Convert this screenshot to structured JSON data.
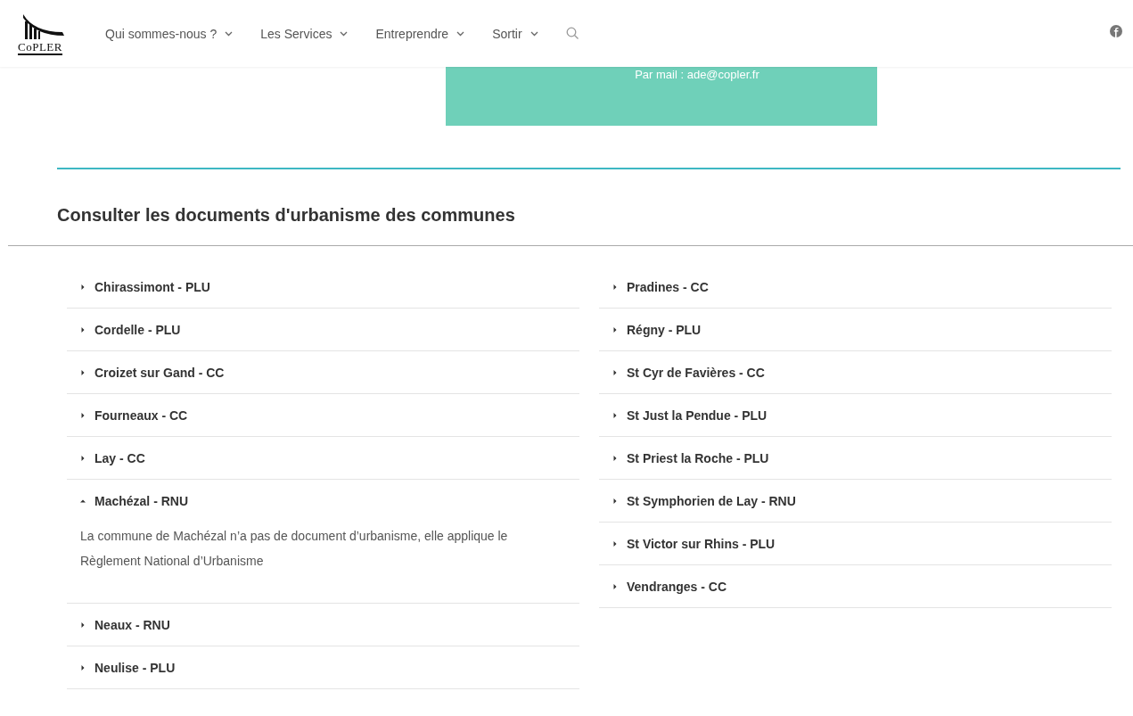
{
  "header": {
    "logo_text": "CoPLER",
    "nav": [
      {
        "label": "Qui sommes-nous ?",
        "has_menu": true
      },
      {
        "label": "Les Services",
        "has_menu": true
      },
      {
        "label": "Entreprendre",
        "has_menu": true
      },
      {
        "label": "Sortir",
        "has_menu": true
      }
    ]
  },
  "contact_box": {
    "text": "Par mail : ade@copler.fr"
  },
  "section": {
    "title": "Consulter les documents d'urbanisme des communes"
  },
  "columns": [
    {
      "items": [
        {
          "title": "Chirassimont - PLU",
          "expanded": false
        },
        {
          "title": "Cordelle - PLU",
          "expanded": false
        },
        {
          "title": "Croizet sur Gand - CC",
          "expanded": false
        },
        {
          "title": "Fourneaux - CC",
          "expanded": false
        },
        {
          "title": "Lay - CC",
          "expanded": false
        },
        {
          "title": "Machézal - RNU",
          "expanded": true,
          "body": "La commune de Machézal n’a pas de document d’urbanisme, elle applique le Règlement National d’Urbanisme"
        },
        {
          "title": "Neaux - RNU",
          "expanded": false
        },
        {
          "title": "Neulise - PLU",
          "expanded": false
        }
      ]
    },
    {
      "items": [
        {
          "title": "Pradines - CC",
          "expanded": false
        },
        {
          "title": "Régny - PLU",
          "expanded": false
        },
        {
          "title": "St Cyr de Favières - CC",
          "expanded": false
        },
        {
          "title": "St Just la Pendue - PLU",
          "expanded": false
        },
        {
          "title": "St Priest la Roche - PLU",
          "expanded": false
        },
        {
          "title": "St Symphorien de Lay - RNU",
          "expanded": false
        },
        {
          "title": "St Victor sur Rhins - PLU",
          "expanded": false
        },
        {
          "title": "Vendranges - CC",
          "expanded": false
        }
      ]
    }
  ]
}
